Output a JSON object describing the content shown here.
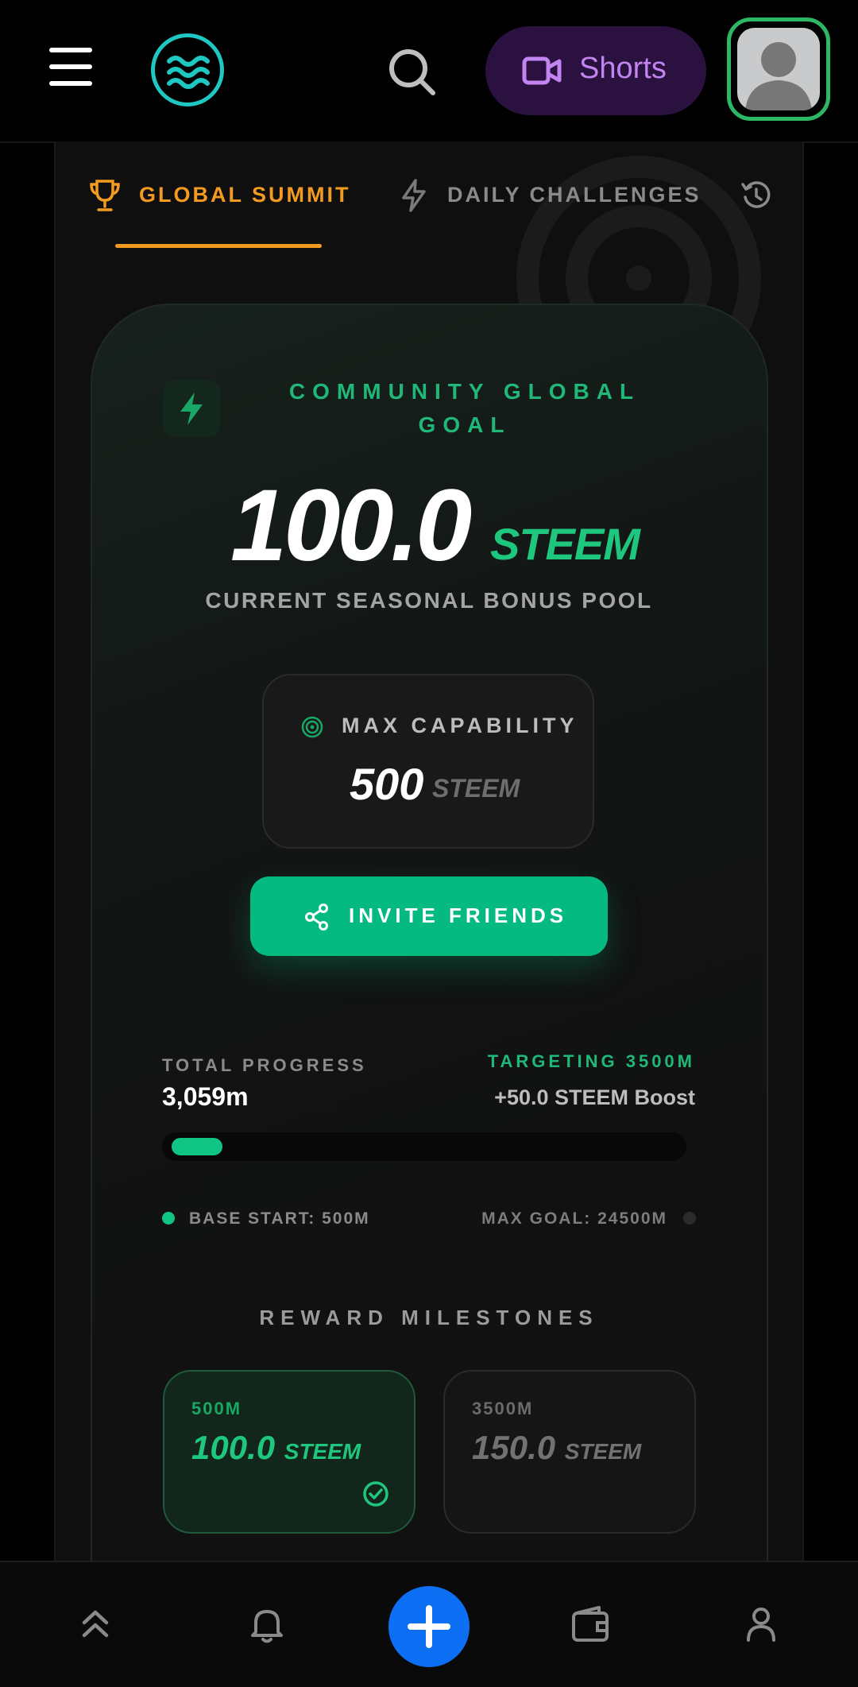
{
  "header": {
    "menu_icon": "hamburger-icon",
    "logo_icon": "waves-logo-icon",
    "search_icon": "search-icon",
    "shorts_label": "Shorts",
    "shorts_icon": "video-camera-icon",
    "avatar_icon": "user-avatar-icon"
  },
  "tabs": [
    {
      "label": "GLOBAL SUMMIT",
      "icon": "trophy-icon",
      "active": true
    },
    {
      "label": "DAILY CHALLENGES",
      "icon": "bolt-icon",
      "active": false
    },
    {
      "label": "",
      "icon": "history-icon",
      "active": false
    }
  ],
  "goal": {
    "title": "COMMUNITY GLOBAL GOAL",
    "amount": "100.0",
    "unit": "STEEM",
    "subtitle": "CURRENT SEASONAL BONUS POOL"
  },
  "max_capability": {
    "label": "MAX CAPABILITY",
    "amount": "500",
    "unit": "STEEM"
  },
  "invite_button": "INVITE FRIENDS",
  "progress": {
    "label": "TOTAL PROGRESS",
    "value": "3,059m",
    "target_label": "TARGETING 3500M",
    "boost": "+50.0 STEEM Boost",
    "fill_fraction": 0.1,
    "base_label": "BASE START: 500M",
    "max_label": "MAX GOAL: 24500M"
  },
  "milestones": {
    "title": "REWARD MILESTONES",
    "items": [
      {
        "distance": "500M",
        "amount": "100.0",
        "unit": "STEEM",
        "completed": true
      },
      {
        "distance": "3500M",
        "amount": "150.0",
        "unit": "STEEM",
        "completed": false
      }
    ]
  },
  "bottom_nav": [
    "double-chevron-up-icon",
    "bell-icon",
    "plus-icon",
    "wallet-icon",
    "profile-icon"
  ],
  "colors": {
    "accent_green": "#1fc77e",
    "tab_orange": "#f39a21",
    "shorts_purple": "#c184f0",
    "fab_blue": "#0d6ff3"
  }
}
